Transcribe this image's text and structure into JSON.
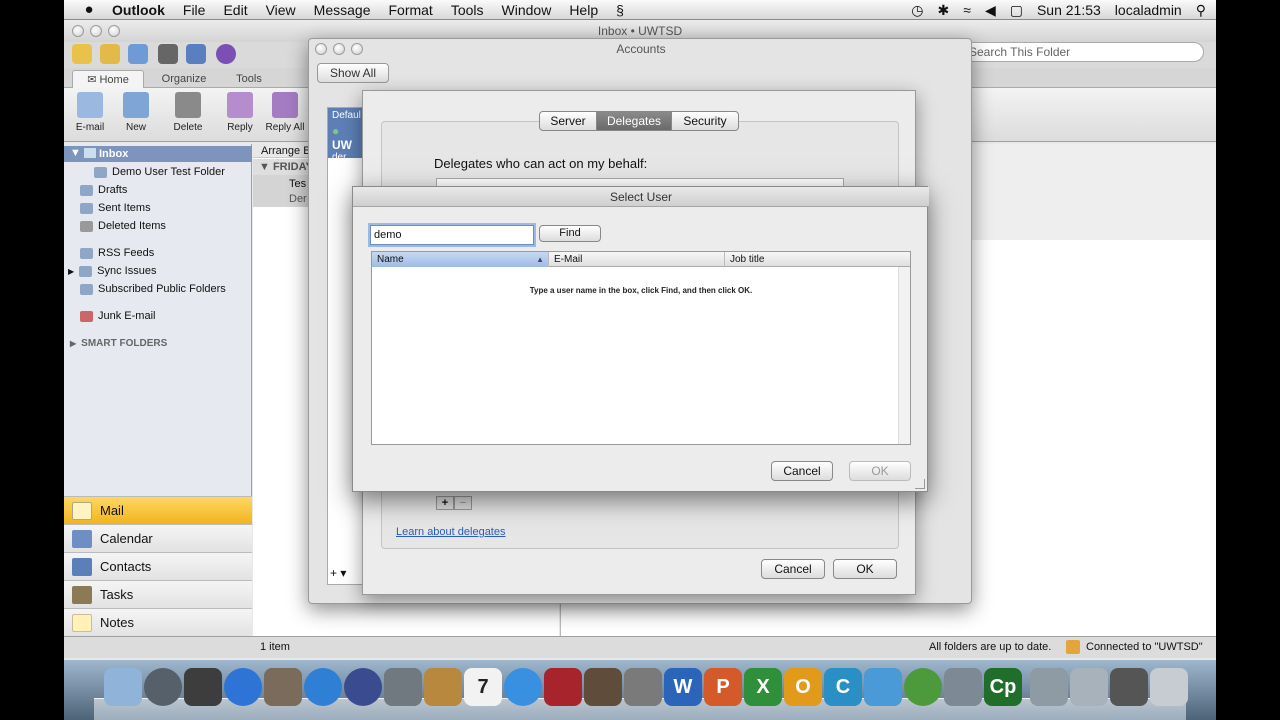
{
  "menubar": {
    "apple": "",
    "items": [
      "Outlook",
      "File",
      "Edit",
      "View",
      "Message",
      "Format",
      "Tools",
      "Window",
      "Help"
    ],
    "clock": "Sun 21:53",
    "user": "localadmin"
  },
  "window": {
    "title": "Inbox • UWTSD",
    "search_placeholder": "Search This Folder"
  },
  "ribbon": {
    "tabs": [
      "Home",
      "Organize",
      "Tools"
    ],
    "buttons": [
      "E-mail",
      "New",
      "Delete",
      "Reply",
      "Reply All"
    ]
  },
  "sidebar": {
    "inbox": "Inbox",
    "folders": [
      "Demo User Test Folder",
      "Drafts",
      "Sent Items",
      "Deleted Items"
    ],
    "other": [
      "RSS Feeds",
      "Sync Issues",
      "Subscribed Public Folders",
      "Junk E-mail"
    ],
    "smart_folders": "SMART FOLDERS",
    "nav": [
      "Mail",
      "Calendar",
      "Contacts",
      "Tasks",
      "Notes"
    ]
  },
  "message_list": {
    "arrange": "Arrange B",
    "group": "FRIDAY",
    "item_from": "Tes",
    "item_sub": "Der"
  },
  "statusbar": {
    "count": "1 item",
    "sync": "All folders are up to date.",
    "connection": "Connected to \"UWTSD\""
  },
  "accounts": {
    "title": "Accounts",
    "show_all": "Show All",
    "list_label": "Defaul",
    "list_account": "UW",
    "list_sub": "der"
  },
  "delegates": {
    "tabs": [
      "Server",
      "Delegates",
      "Security"
    ],
    "heading": "Delegates who can act on my behalf:",
    "learn": "Learn about delegates",
    "cancel": "Cancel",
    "ok": "OK"
  },
  "select_user": {
    "title": "Select User",
    "input_value": "demo",
    "find": "Find",
    "columns": [
      "Name",
      "E-Mail",
      "Job title"
    ],
    "hint": "Type a user name in the box, click Find, and then click OK.",
    "cancel": "Cancel",
    "ok": "OK"
  },
  "dock": {
    "cp_label": "Cp"
  }
}
